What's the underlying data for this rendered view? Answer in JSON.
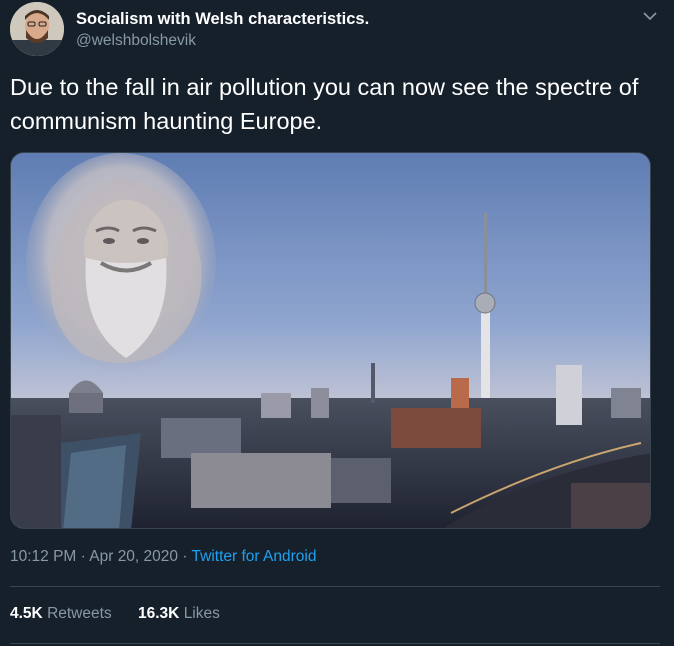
{
  "tweet": {
    "author": {
      "name": "Socialism with Welsh characteristics.",
      "handle": "@welshbolshevik"
    },
    "text": "Due to the fall in air pollution you can now see the spectre of communism haunting Europe.",
    "timestamp": "10:12 PM · Apr 20, 2020 · ",
    "source": "Twitter for Android",
    "stats": {
      "retweets_count": "4.5K",
      "retweets_label": "Retweets",
      "likes_count": "16.3K",
      "likes_label": "Likes"
    }
  },
  "icons": {
    "menu": "chevron-down-icon"
  },
  "colors": {
    "background": "#15202b",
    "secondary_text": "#8899a6",
    "link": "#1da1f2",
    "border": "#38444d"
  }
}
